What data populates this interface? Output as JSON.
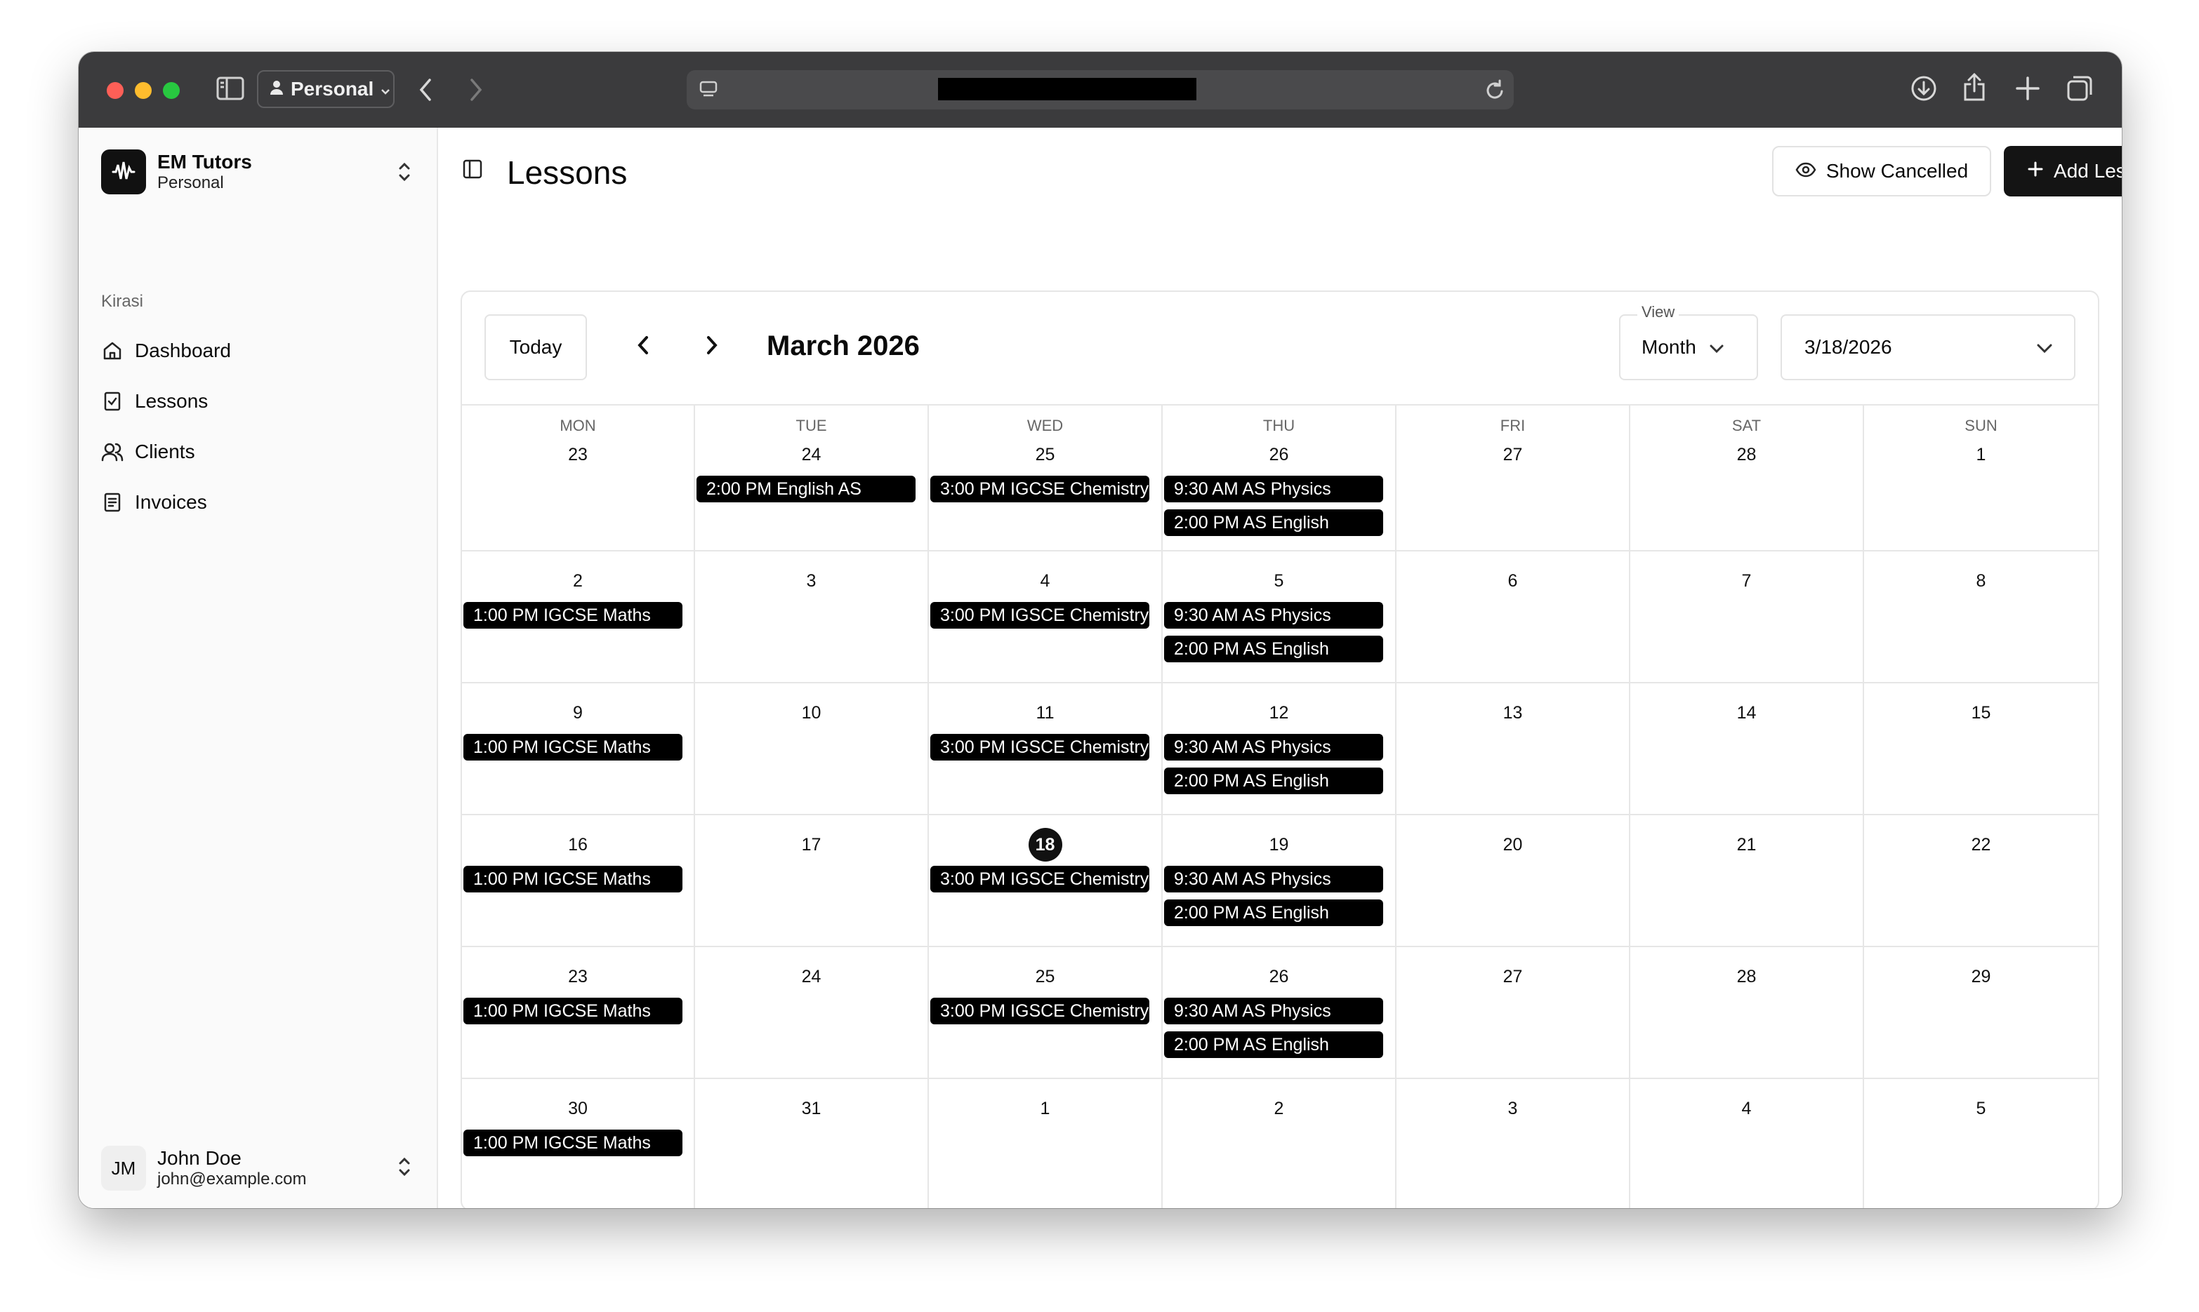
{
  "browser": {
    "profile_label": "Personal",
    "url": "███████████████████"
  },
  "sidebar": {
    "org_name": "EM Tutors",
    "org_sub": "Personal",
    "group_label": "Kirasi",
    "items": [
      {
        "label": "Dashboard",
        "icon": "home-icon"
      },
      {
        "label": "Lessons",
        "icon": "checklist-icon"
      },
      {
        "label": "Clients",
        "icon": "users-icon"
      },
      {
        "label": "Invoices",
        "icon": "invoice-icon"
      }
    ],
    "user": {
      "initials": "JM",
      "name": "John Doe",
      "email": "john@example.com"
    }
  },
  "header": {
    "title": "Lessons",
    "show_cancelled_label": "Show Cancelled",
    "add_lesson_label": "Add Lesson"
  },
  "calendar": {
    "today_label": "Today",
    "month_title": "March 2026",
    "view_label": "View",
    "view_value": "Month",
    "date_value": "3/18/2026",
    "weekdays": [
      "MON",
      "TUE",
      "WED",
      "THU",
      "FRI",
      "SAT",
      "SUN"
    ],
    "weeks": [
      [
        {
          "day": "23",
          "events": []
        },
        {
          "day": "24",
          "events": [
            "2:00 PM English AS"
          ]
        },
        {
          "day": "25",
          "events": [
            "3:00 PM IGCSE Chemistry"
          ]
        },
        {
          "day": "26",
          "events": [
            "9:30 AM AS Physics",
            "2:00 PM AS English"
          ]
        },
        {
          "day": "27",
          "events": []
        },
        {
          "day": "28",
          "events": []
        },
        {
          "day": "1",
          "events": []
        }
      ],
      [
        {
          "day": "2",
          "events": [
            "1:00 PM IGCSE Maths"
          ]
        },
        {
          "day": "3",
          "events": []
        },
        {
          "day": "4",
          "events": [
            "3:00 PM IGSCE Chemistry"
          ]
        },
        {
          "day": "5",
          "events": [
            "9:30 AM AS Physics",
            "2:00 PM AS English"
          ]
        },
        {
          "day": "6",
          "events": []
        },
        {
          "day": "7",
          "events": []
        },
        {
          "day": "8",
          "events": []
        }
      ],
      [
        {
          "day": "9",
          "events": [
            "1:00 PM IGCSE Maths"
          ]
        },
        {
          "day": "10",
          "events": []
        },
        {
          "day": "11",
          "events": [
            "3:00 PM IGSCE Chemistry"
          ]
        },
        {
          "day": "12",
          "events": [
            "9:30 AM AS Physics",
            "2:00 PM AS English"
          ]
        },
        {
          "day": "13",
          "events": []
        },
        {
          "day": "14",
          "events": []
        },
        {
          "day": "15",
          "events": []
        }
      ],
      [
        {
          "day": "16",
          "events": [
            "1:00 PM IGCSE Maths"
          ]
        },
        {
          "day": "17",
          "events": []
        },
        {
          "day": "18",
          "events": [
            "3:00 PM IGSCE Chemistry"
          ],
          "today": true
        },
        {
          "day": "19",
          "events": [
            "9:30 AM AS Physics",
            "2:00 PM AS English"
          ]
        },
        {
          "day": "20",
          "events": []
        },
        {
          "day": "21",
          "events": []
        },
        {
          "day": "22",
          "events": []
        }
      ],
      [
        {
          "day": "23",
          "events": [
            "1:00 PM IGCSE Maths"
          ]
        },
        {
          "day": "24",
          "events": []
        },
        {
          "day": "25",
          "events": [
            "3:00 PM IGSCE Chemistry"
          ]
        },
        {
          "day": "26",
          "events": [
            "9:30 AM AS Physics",
            "2:00 PM AS English"
          ]
        },
        {
          "day": "27",
          "events": []
        },
        {
          "day": "28",
          "events": []
        },
        {
          "day": "29",
          "events": []
        }
      ],
      [
        {
          "day": "30",
          "events": [
            "1:00 PM IGCSE Maths"
          ]
        },
        {
          "day": "31",
          "events": []
        },
        {
          "day": "1",
          "events": []
        },
        {
          "day": "2",
          "events": []
        },
        {
          "day": "3",
          "events": []
        },
        {
          "day": "4",
          "events": []
        },
        {
          "day": "5",
          "events": []
        }
      ]
    ]
  },
  "colors": {
    "accent": "#141414",
    "event_bg": "#000000",
    "chrome": "#3b3b3d"
  }
}
